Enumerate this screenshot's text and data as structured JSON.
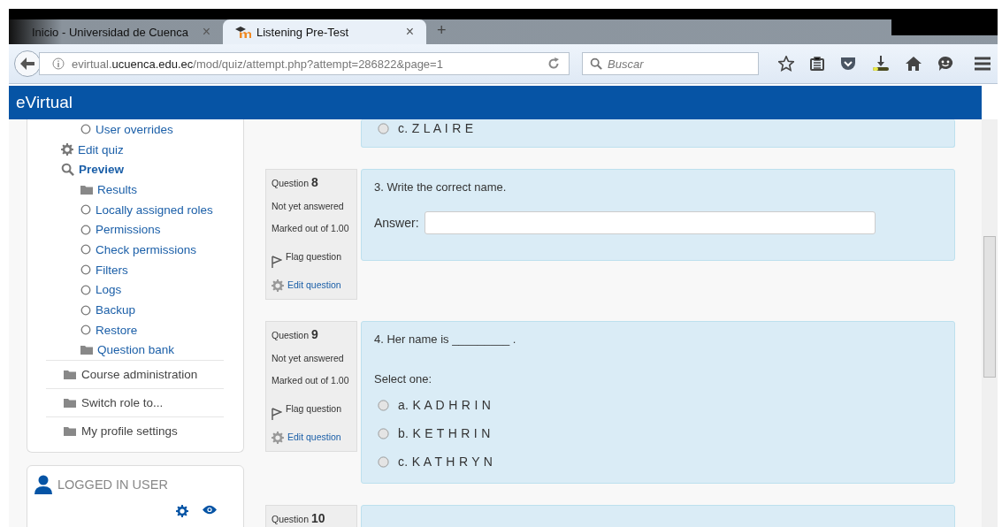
{
  "browser": {
    "tabs": [
      {
        "title": "Inicio - Universidad de Cuenca",
        "selected": false,
        "close": "×"
      },
      {
        "title": "Listening Pre-Test",
        "selected": true,
        "close": "×"
      }
    ],
    "new_tab": "+",
    "url": {
      "prefix": "evirtual.",
      "host": "ucuenca.edu.ec",
      "path": "/mod/quiz/attempt.php?attempt=286822&page=1"
    },
    "search": {
      "placeholder": "Buscar"
    }
  },
  "header": {
    "brand": "eVirtual"
  },
  "navigation": {
    "cut_items": [
      {
        "label": "User overrides",
        "kind": "circle"
      }
    ],
    "items": [
      {
        "label": "Edit quiz",
        "kind": "gear",
        "bold": false
      },
      {
        "label": "Preview",
        "kind": "search",
        "bold": true,
        "children": [
          {
            "label": "Results",
            "kind": "folder"
          },
          {
            "label": "Locally assigned roles",
            "kind": "circle"
          },
          {
            "label": "Permissions",
            "kind": "circle"
          },
          {
            "label": "Check permissions",
            "kind": "circle"
          },
          {
            "label": "Filters",
            "kind": "circle"
          },
          {
            "label": "Logs",
            "kind": "circle"
          },
          {
            "label": "Backup",
            "kind": "circle"
          },
          {
            "label": "Restore",
            "kind": "circle"
          },
          {
            "label": "Question bank",
            "kind": "folder"
          }
        ]
      }
    ],
    "sections": [
      {
        "label": "Course administration"
      },
      {
        "label": "Switch role to..."
      },
      {
        "label": "My profile settings"
      }
    ]
  },
  "logged_in_block": {
    "title": "LOGGED IN USER"
  },
  "previous_tail": {
    "options": [
      {
        "text": "c. Z L A I R E",
        "selected": false
      }
    ]
  },
  "questions": [
    {
      "kind": "shortanswer",
      "label": "Question",
      "number": "8",
      "state": "Not yet answered",
      "marks": "Marked out of 1.00",
      "flag": "Flag question",
      "edit": "Edit question",
      "prompt": "3. Write the correct name.",
      "answer_label": "Answer:"
    },
    {
      "kind": "multichoice",
      "label": "Question",
      "number": "9",
      "state": "Not yet answered",
      "marks": "Marked out of 1.00",
      "flag": "Flag question",
      "edit": "Edit question",
      "prompt": "4. Her name is _________ .",
      "select_label": "Select one:",
      "options": [
        {
          "text": "a. K A D H R I N",
          "selected": false
        },
        {
          "text": "b. K E T H R I N",
          "selected": false
        },
        {
          "text": "c. K A T H R Y N",
          "selected": false
        }
      ]
    },
    {
      "kind": "cut",
      "label": "Question",
      "number": "10"
    }
  ]
}
